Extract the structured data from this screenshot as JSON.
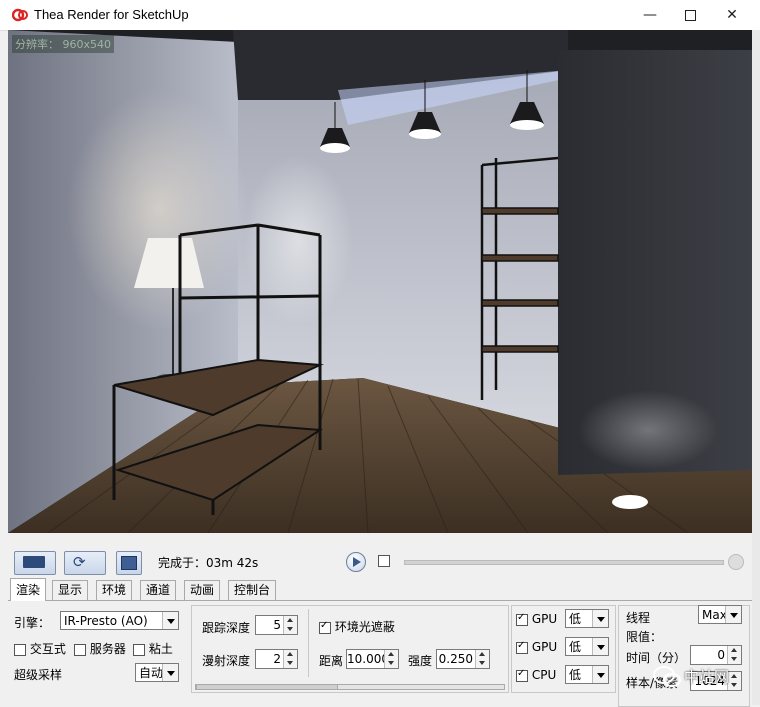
{
  "window": {
    "title": "Thea Render for SketchUp",
    "minimize_icon": "minimize-icon",
    "maximize_icon": "maximize-icon",
    "close_icon": "close-icon"
  },
  "viewport": {
    "resolution_label": "分辨率： 960x540"
  },
  "toolbar": {
    "status_text": "完成于：03m 42s",
    "progress_checkbox_checked": false
  },
  "tabs": [
    {
      "label": "渲染",
      "active": true
    },
    {
      "label": "显示",
      "active": false
    },
    {
      "label": "环境",
      "active": false
    },
    {
      "label": "通道",
      "active": false
    },
    {
      "label": "动画",
      "active": false
    },
    {
      "label": "控制台",
      "active": false
    }
  ],
  "render_panel": {
    "engine_label": "引擎：",
    "engine_value": "IR-Presto (AO)",
    "interactive_label": "交互式",
    "server_label": "服务器",
    "clay_label": "粘土",
    "supersampling_label": "超级采样",
    "supersampling_value": "自动",
    "trace_depth_label": "跟踪深度",
    "trace_depth_value": "5",
    "diffuse_depth_label": "漫射深度",
    "diffuse_depth_value": "2",
    "ao_label": "环境光遮蔽",
    "ao_checked": true,
    "distance_label": "距离",
    "distance_value": "10.000",
    "intensity_label": "强度",
    "intensity_value": "0.250",
    "devices": [
      {
        "label": "GPU",
        "checked": true,
        "priority": "低"
      },
      {
        "label": "GPU",
        "checked": true,
        "priority": "低"
      },
      {
        "label": "CPU",
        "checked": true,
        "priority": "低"
      }
    ],
    "threads_label": "线程",
    "threads_value": "Max",
    "limit_label": "限值：",
    "time_label": "时间（分）",
    "time_value": "0",
    "samples_label": "样本/像素",
    "samples_value": "1024"
  },
  "watermark": {
    "text": "中站网"
  },
  "colors": {
    "accent": "#3b5a8a",
    "scene_wall": "#8f94a3",
    "scene_floor": "#5a4632"
  }
}
